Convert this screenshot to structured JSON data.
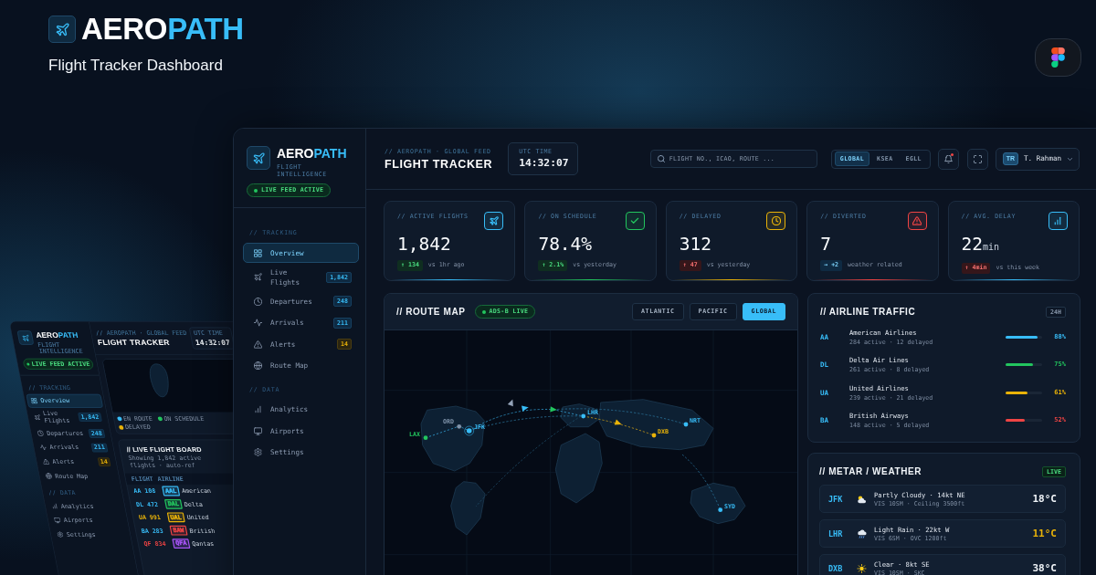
{
  "banner": {
    "logo_lead": "AERO",
    "logo_accent": "PATH",
    "subtitle": "Flight Tracker Dashboard"
  },
  "preview_mockup": {
    "sidebar": {
      "brand_lead": "AERO",
      "brand_accent": "PATH",
      "tagline": "FLIGHT INTELLIGENCE",
      "status": "LIVE FEED ACTIVE",
      "sections": [
        {
          "title": "// TRACKING",
          "items": [
            {
              "label": "Overview",
              "selected": true
            },
            {
              "label": "Live Flights",
              "selected": false,
              "badge": "1,842",
              "alert": false
            },
            {
              "label": "Departures",
              "selected": false,
              "badge": "248",
              "alert": false
            },
            {
              "label": "Arrivals",
              "selected": false,
              "badge": "211",
              "alert": false
            },
            {
              "label": "Alerts",
              "selected": false,
              "badge": "14",
              "alert": true
            },
            {
              "label": "Route Map",
              "selected": false
            }
          ]
        },
        {
          "title": "// DATA",
          "items": [
            {
              "label": "Analytics",
              "selected": false
            },
            {
              "label": "Airports",
              "selected": false
            },
            {
              "label": "Settings",
              "selected": false
            }
          ]
        }
      ]
    },
    "topbar": {
      "eyebrow": "// AEROPATH · GLOBAL FEED",
      "title": "FLIGHT TRACKER",
      "clock_label": "UTC TIME",
      "clock": "14:32:07"
    },
    "map_legend": [
      {
        "label": "EN ROUTE",
        "color": "#38bdf8"
      },
      {
        "label": "ON SCHEDULE",
        "color": "#22c55e"
      },
      {
        "label": "DELAYED",
        "color": "#eab308"
      }
    ],
    "flight_board": {
      "title": "// LIVE FLIGHT BOARD",
      "subtitle": "Showing 1,842 active flights · auto-ref",
      "columns": [
        "FLIGHT",
        "AIRLINE"
      ],
      "rows": [
        {
          "flight": "AA 108",
          "delayed": false,
          "diverted": false,
          "airline_code": "AAL",
          "color": "#38bdf8",
          "airline": "American"
        },
        {
          "flight": "DL 472",
          "delayed": false,
          "diverted": false,
          "airline_code": "DAL",
          "color": "#22c55e",
          "airline": "Delta"
        },
        {
          "flight": "UA 991",
          "delayed": true,
          "diverted": false,
          "airline_code": "UAL",
          "color": "#eab308",
          "airline": "United"
        },
        {
          "flight": "BA 283",
          "delayed": false,
          "diverted": false,
          "airline_code": "BAW",
          "color": "#ef4444",
          "airline": "British"
        },
        {
          "flight": "QF 834",
          "delayed": false,
          "diverted": true,
          "airline_code": "QFA",
          "color": "#a855f7",
          "airline": "Qantas"
        }
      ]
    }
  },
  "dashboard": {
    "sidebar": {
      "brand_lead": "AERO",
      "brand_accent": "PATH",
      "tagline": "FLIGHT INTELLIGENCE",
      "status": "LIVE FEED ACTIVE",
      "sections": [
        {
          "title": "// TRACKING",
          "items": [
            {
              "label": "Overview",
              "selected": true
            },
            {
              "label": "Live Flights",
              "selected": false,
              "badge": "1,842",
              "alert": false
            },
            {
              "label": "Departures",
              "selected": false,
              "badge": "248",
              "alert": false
            },
            {
              "label": "Arrivals",
              "selected": false,
              "badge": "211",
              "alert": false
            },
            {
              "label": "Alerts",
              "selected": false,
              "badge": "14",
              "alert": true
            },
            {
              "label": "Route Map",
              "selected": false
            }
          ]
        },
        {
          "title": "// DATA",
          "items": [
            {
              "label": "Analytics",
              "selected": false
            },
            {
              "label": "Airports",
              "selected": false
            },
            {
              "label": "Settings",
              "selected": false
            }
          ]
        }
      ]
    },
    "topbar": {
      "eyebrow": "// AEROPATH · GLOBAL FEED",
      "title": "FLIGHT TRACKER",
      "clock_label": "UTC TIME",
      "clock": "14:32:07",
      "search_placeholder": "FLIGHT NO., ICAO, ROUTE ...",
      "regions": [
        {
          "label": "GLOBAL",
          "selected": true
        },
        {
          "label": "KSEA",
          "selected": false
        },
        {
          "label": "EGLL",
          "selected": false
        }
      ],
      "notifications_unread": true,
      "user": {
        "initials": "TR",
        "name": "T. Rahman"
      }
    },
    "stats": [
      {
        "label": "// ACTIVE FLIGHTS",
        "value": "1,842",
        "delta": "↑ 134",
        "kind": "positive",
        "note": "vs 1hr ago",
        "color": "#38bdf8"
      },
      {
        "label": "// ON SCHEDULE",
        "value": "78.4%",
        "delta": "↑ 2.1%",
        "kind": "positive",
        "note": "vs yesterday",
        "color": "#22c55e"
      },
      {
        "label": "// DELAYED",
        "value": "312",
        "delta": "↑ 47",
        "kind": "negative",
        "note": "vs yesterday",
        "color": "#eab308"
      },
      {
        "label": "// DIVERTED",
        "value": "7",
        "delta": "→ +2",
        "kind": "neutral",
        "note": "weather related",
        "color": "#ef4444"
      },
      {
        "label": "// AVG. DELAY",
        "value": "22",
        "unit": "min",
        "delta": "↑ 4min",
        "kind": "negative",
        "note": "vs this week",
        "color": "#38bdf8"
      }
    ],
    "route_map": {
      "title": "// ROUTE MAP",
      "live_badge": "ADS-B LIVE",
      "views": [
        {
          "label": "ATLANTIC",
          "selected": false
        },
        {
          "label": "PACIFIC",
          "selected": false
        },
        {
          "label": "GLOBAL",
          "selected": true
        }
      ],
      "airports": [
        {
          "code": "LAX",
          "color": "#22c55e",
          "hub": false
        },
        {
          "code": "ORD",
          "color": "#7f93aa",
          "hub": false
        },
        {
          "code": "JFK",
          "color": "#38bdf8",
          "hub": true
        },
        {
          "code": "LHR",
          "color": "#38bdf8",
          "hub": false
        },
        {
          "code": "DXB",
          "color": "#eab308",
          "hub": false
        },
        {
          "code": "NRT",
          "color": "#38bdf8",
          "hub": false
        },
        {
          "code": "SYD",
          "color": "#38bdf8",
          "hub": false
        }
      ],
      "planes": [
        {
          "color": "#94a3b8"
        },
        {
          "color": "#38bdf8"
        },
        {
          "color": "#22c55e"
        },
        {
          "color": "#eab308"
        }
      ]
    },
    "airline_traffic": {
      "title": "// AIRLINE TRAFFIC",
      "period": "24H",
      "airlines": [
        {
          "code": "AA",
          "name": "American Airlines",
          "detail": "284 active · 12 delayed",
          "level": 0.88,
          "share": "88%",
          "color": "#38bdf8"
        },
        {
          "code": "DL",
          "name": "Delta Air Lines",
          "detail": "261 active · 8 delayed",
          "level": 0.75,
          "share": "75%",
          "color": "#22c55e"
        },
        {
          "code": "UA",
          "name": "United Airlines",
          "detail": "239 active · 21 delayed",
          "level": 0.61,
          "share": "61%",
          "color": "#eab308"
        },
        {
          "code": "BA",
          "name": "British Airways",
          "detail": "148 active · 5 delayed",
          "level": 0.52,
          "share": "52%",
          "color": "#ef4444"
        }
      ]
    },
    "weather": {
      "title": "// METAR / WEATHER",
      "live_badge": "LIVE",
      "stations": [
        {
          "code": "JFK",
          "conditions": "Partly Cloudy · 14kt NE",
          "details": "VIS 10SM · Ceiling 3500ft",
          "temperature": "18°C",
          "warning": false
        },
        {
          "code": "LHR",
          "conditions": "Light Rain · 22kt W",
          "details": "VIS 6SM · OVC 1200ft",
          "temperature": "11°C",
          "warning": true
        },
        {
          "code": "DXB",
          "conditions": "Clear · 8kt SE",
          "details": "VIS 10SM · SKC",
          "temperature": "38°C",
          "warning": false
        }
      ]
    }
  }
}
